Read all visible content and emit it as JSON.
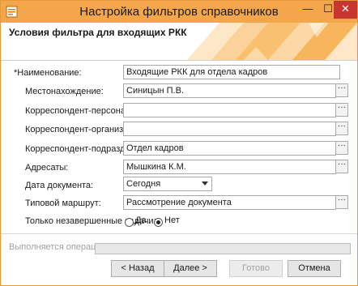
{
  "window": {
    "title": "Настройка фильтров справочников",
    "minimize_glyph": "—",
    "maximize_glyph": "☐",
    "close_glyph": "✕",
    "accent_color": "#f4a64a",
    "close_color": "#c7372f"
  },
  "header": {
    "title": "Условия фильтра для входящих РКК"
  },
  "form": {
    "name_label": "*Наименование:",
    "name_value": "Входящие РКК для отдела кадров",
    "location_label": "Местонахождение:",
    "location_value": "Синицын П.В.",
    "corr_person_label": "Корреспондент-персона:",
    "corr_person_value": "",
    "corr_org_label": "Корреспондент-организация:",
    "corr_org_value": "",
    "corr_dept_label": "Корреспондент-подразделение:",
    "corr_dept_value": "Отдел кадров",
    "addressees_label": "Адресаты:",
    "addressees_value": "Мышкина К.М.",
    "doc_date_label": "Дата документа:",
    "doc_date_value": "Сегодня",
    "route_label": "Типовой маршрут:",
    "route_value": "Рассмотрение документа",
    "unfinished_label": "Только незавершенные задачи:",
    "option_yes": "Да",
    "option_no": "Нет",
    "selected_option": "Нет",
    "ellipsis": "···"
  },
  "status": {
    "operation_label": "Выполняется операция",
    "progress_fraction": 0
  },
  "buttons": {
    "back": "< Назад",
    "next": "Далее >",
    "finish": "Готово",
    "cancel": "Отмена"
  }
}
